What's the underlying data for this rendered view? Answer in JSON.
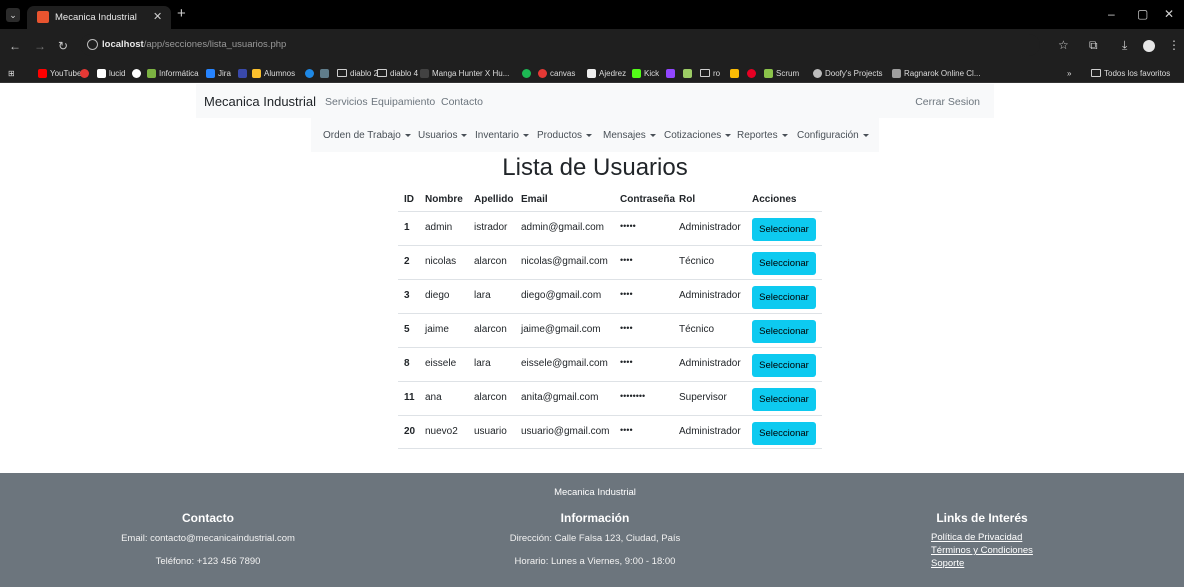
{
  "browser": {
    "tab_title": "Mecanica Industrial",
    "url_host": "localhost",
    "url_path": "/app/secciones/lista_usuarios.php",
    "bookmarks": [
      "YouTube",
      "lucid",
      "Informática",
      "Jira",
      "Alumnos",
      "diablo 2",
      "diablo 4",
      "Manga Hunter X Hu...",
      "canvas",
      "Ajedrez",
      "Kick",
      "ro",
      "Scrum",
      "Doofy's Projects",
      "Ragnarok Online Cl..."
    ],
    "all_bookmarks": "Todos los favoritos"
  },
  "navbar": {
    "brand": "Mecanica Industrial",
    "links": [
      "Servicios",
      "Equipamiento",
      "Contacto"
    ],
    "logout": "Cerrar Sesion"
  },
  "subnav": {
    "items": [
      "Orden de Trabajo",
      "Usuarios",
      "Inventario",
      "Productos",
      "Mensajes",
      "Cotizaciones",
      "Reportes",
      "Configuración"
    ]
  },
  "page_title": "Lista de Usuarios",
  "table": {
    "headers": [
      "ID",
      "Nombre",
      "Apellido",
      "Email",
      "Contraseña",
      "Rol",
      "Acciones"
    ],
    "rows": [
      {
        "id": "1",
        "nombre": "admin",
        "apellido": "istrador",
        "email": "admin@gmail.com",
        "password": "•••••",
        "rol": "Administrador",
        "action": "Seleccionar"
      },
      {
        "id": "2",
        "nombre": "nicolas",
        "apellido": "alarcon",
        "email": "nicolas@gmail.com",
        "password": "••••",
        "rol": "Técnico",
        "action": "Seleccionar"
      },
      {
        "id": "3",
        "nombre": "diego",
        "apellido": "lara",
        "email": "diego@gmail.com",
        "password": "••••",
        "rol": "Administrador",
        "action": "Seleccionar"
      },
      {
        "id": "5",
        "nombre": "jaime",
        "apellido": "alarcon",
        "email": "jaime@gmail.com",
        "password": "••••",
        "rol": "Técnico",
        "action": "Seleccionar"
      },
      {
        "id": "8",
        "nombre": "eissele",
        "apellido": "lara",
        "email": "eissele@gmail.com",
        "password": "••••",
        "rol": "Administrador",
        "action": "Seleccionar"
      },
      {
        "id": "11",
        "nombre": "ana",
        "apellido": "alarcon",
        "email": "anita@gmail.com",
        "password": "••••••••",
        "rol": "Supervisor",
        "action": "Seleccionar"
      },
      {
        "id": "20",
        "nombre": "nuevo2",
        "apellido": "usuario",
        "email": "usuario@gmail.com",
        "password": "••••",
        "rol": "Administrador",
        "action": "Seleccionar"
      }
    ]
  },
  "footer": {
    "brand": "Mecanica Industrial",
    "contact_title": "Contacto",
    "contact_email": "Email: contacto@mecanicaindustrial.com",
    "contact_phone": "Teléfono: +123 456 7890",
    "info_title": "Información",
    "info_address": "Dirección: Calle Falsa 123, Ciudad, País",
    "info_hours": "Horario: Lunes a Viernes, 9:00 - 18:00",
    "links_title": "Links de Interés",
    "links": [
      "Política de Privacidad",
      "Términos y Condiciones",
      "Soporte"
    ]
  },
  "colors": {
    "select_button": "#0dcaf0",
    "footer_bg": "#6c757d",
    "navbar_bg": "#f8f9fa"
  }
}
